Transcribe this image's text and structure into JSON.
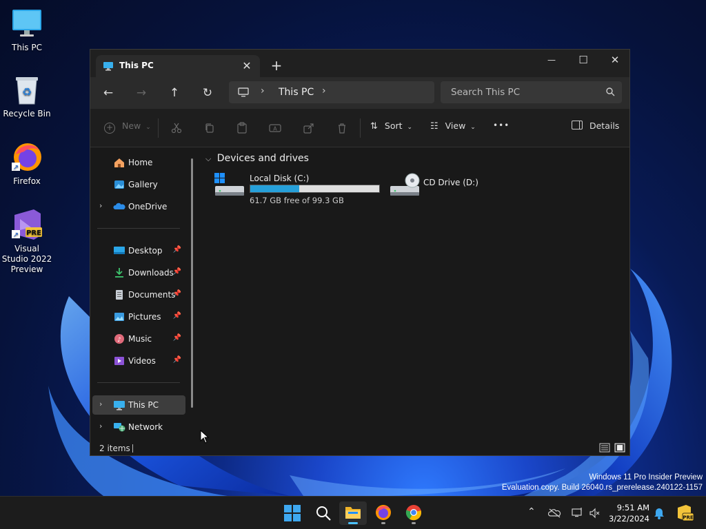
{
  "desktop": {
    "icons": [
      {
        "label": "This PC"
      },
      {
        "label": "Recycle Bin"
      },
      {
        "label": "Firefox"
      },
      {
        "label": "Visual Studio 2022 Preview",
        "badge": "PRE"
      }
    ],
    "watermark_line1": "Windows 11 Pro Insider Preview",
    "watermark_line2": "Evaluation copy. Build 26040.rs_prerelease.240122-1157"
  },
  "window": {
    "tab_title": "This PC",
    "tab_close": "✕",
    "new_tab": "+",
    "minimize": "—",
    "maximize": "☐",
    "close": "✕",
    "nav": {
      "back": "←",
      "forward": "→",
      "up": "↑",
      "refresh": "↻"
    },
    "address": {
      "crumb": "This PC",
      "sep": "›"
    },
    "search": {
      "placeholder": "Search This PC"
    },
    "toolbar": {
      "new_label": "New",
      "sort_label": "Sort",
      "view_label": "View",
      "more": "•••",
      "details_label": "Details"
    },
    "sidebar": {
      "items": [
        {
          "label": "Home"
        },
        {
          "label": "Gallery"
        },
        {
          "label": "OneDrive"
        },
        {
          "label": "Desktop"
        },
        {
          "label": "Downloads"
        },
        {
          "label": "Documents"
        },
        {
          "label": "Pictures"
        },
        {
          "label": "Music"
        },
        {
          "label": "Videos"
        },
        {
          "label": "This PC"
        },
        {
          "label": "Network"
        }
      ]
    },
    "main": {
      "group_header": "Devices and drives",
      "drives": [
        {
          "name": "Local Disk (C:)",
          "free_text": "61.7 GB free of 99.3 GB",
          "used_fraction": 0.379
        },
        {
          "name": "CD Drive (D:)"
        }
      ]
    },
    "status": {
      "item_count": "2 items"
    }
  },
  "taskbar": {
    "time": "9:51 AM",
    "date": "3/22/2024",
    "tray_badge": "PRE"
  },
  "colors": {
    "accent": "#26a0da",
    "window_bg": "#191919",
    "taskbar_bg": "#1c1c1c"
  }
}
